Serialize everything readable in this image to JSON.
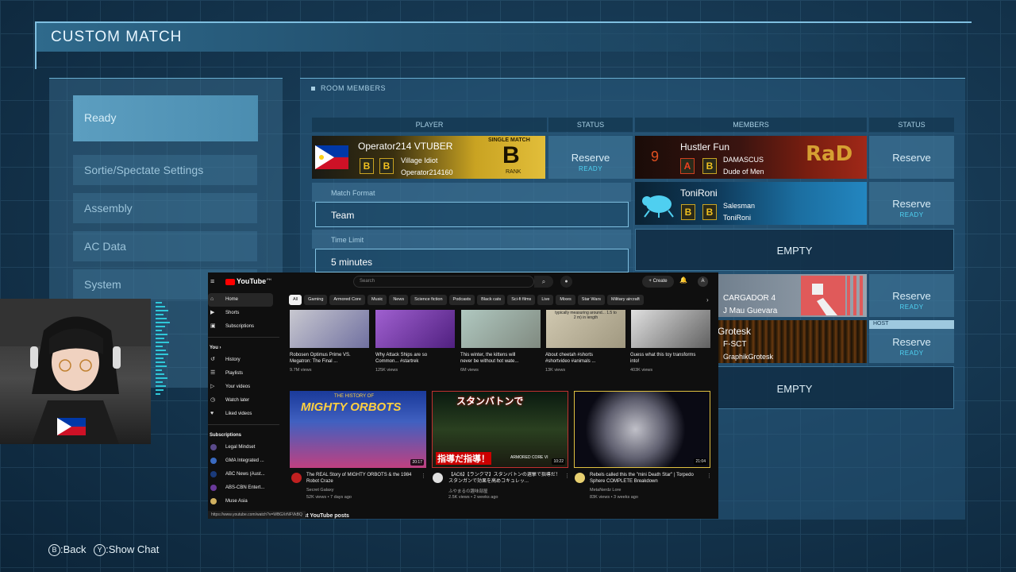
{
  "screen_title": "CUSTOM MATCH",
  "menu": {
    "items": [
      "Ready",
      "Sortie/Spectate Settings",
      "Assembly",
      "AC Data",
      "System"
    ]
  },
  "room": {
    "label": "ROOM MEMBERS",
    "headers": {
      "player": "PLAYER",
      "status_left": "STATUS",
      "members": "MEMBERS",
      "status_right": "STATUS"
    },
    "host_player": {
      "name": "Operator214 VTUBER",
      "title": "Village Idiot",
      "id": "Operator214160",
      "rank_label": "SINGLE MATCH",
      "rank": "B",
      "rank_word": "RANK",
      "badges": [
        "B",
        "B"
      ],
      "status": "Reserve",
      "status_sub": "READY"
    },
    "match_format": {
      "label": "Match Format",
      "value": "Team"
    },
    "time_limit": {
      "label": "Time Limit",
      "value": "5 minutes"
    },
    "members": [
      {
        "name": "Hustler Fun",
        "emblem_num": "9",
        "title": "DAMASCUS",
        "id": "Dude of Men",
        "badges": [
          "A",
          "B"
        ],
        "logo": "RaD",
        "status": "Reserve",
        "status_sub": ""
      },
      {
        "name": "ToniRoni",
        "title": "Salesman",
        "id": "ToniRoni",
        "badges": [
          "B",
          "B"
        ],
        "status": "Reserve",
        "status_sub": "READY"
      },
      {
        "empty_label": "EMPTY"
      },
      {
        "name": "CARGADOR 4",
        "id": "J Mau Guevara",
        "status": "Reserve",
        "status_sub": "READY"
      },
      {
        "name": "Grotesk",
        "title": "F-SCT",
        "id": "GraphikGrotesk",
        "host_tag": "HOST",
        "status": "Reserve",
        "status_sub": "READY"
      },
      {
        "empty_label": "EMPTY"
      }
    ]
  },
  "youtube": {
    "logo": "YouTube",
    "region": "PH",
    "search_placeholder": "Search",
    "create_label": "Create",
    "sidebar": {
      "main": [
        "Home",
        "Shorts",
        "Subscriptions"
      ],
      "you_heading": "You",
      "you_items": [
        "History",
        "Playlists",
        "Your videos",
        "Watch later",
        "Liked videos"
      ],
      "subs_heading": "Subscriptions",
      "subs": [
        "Legal Mindset",
        "GMA Integrated ...",
        "ABC News (Aust...",
        "ABS-CBN Entert...",
        "Muse Asia"
      ]
    },
    "chips": [
      "All",
      "Gaming",
      "Armored Core",
      "Music",
      "News",
      "Science fiction",
      "Podcasts",
      "Black cats",
      "Sci-fi films",
      "Live",
      "Mixes",
      "Star Wars",
      "Military aircraft"
    ],
    "shorts": [
      {
        "title": "Robosen Optimus Prime VS. Megatron: The Final ...",
        "views": "9.7M views"
      },
      {
        "title": "Why Attack Ships are so Common... #startrek",
        "views": "125K views"
      },
      {
        "title": "This winter, the kittens will never be without hot wate...",
        "views": "6M views"
      },
      {
        "title": "About cheetah #shorts #shortvideo #animals ...",
        "views": "13K views",
        "overlay": "typically measuring around... 1.5 to 2 m) in length"
      },
      {
        "title": "Guess what this toy transforms into!",
        "views": "403K views"
      }
    ],
    "videos": [
      {
        "title": "The REAL Story of MIGHTY ORBOTS & the 1984 Robot Craze",
        "channel": "Secret Galaxy",
        "meta": "52K views • 7 days ago",
        "duration": "20:17",
        "thumb_text": "MIGHTY ORBOTS",
        "thumb_small": "THE HISTORY OF"
      },
      {
        "title": "【AC6】【ランクマ】スタンバトンの選撃で指導だ！スタンガンで効果を高めコキュレッ...",
        "channel": "ふやまるの趣味部屋",
        "meta": "2.5K views • 2 weeks ago",
        "duration": "10:22",
        "thumb_text": "スタンバトンで",
        "thumb_bottom": "指導だ指導！",
        "thumb_logo": "ARMORED CORE VI"
      },
      {
        "title": "Rebels called this the \"mini Death Star\" | Torpedo Sphere COMPLETE Breakdown",
        "channel": "MetaNerdz Lore",
        "meta": "83K views • 3 weeks ago",
        "duration": "21:04"
      }
    ],
    "section_heading": "Latest YouTube posts",
    "status_url": "https://www.youtube.com/watch?v=WBGXrNFVkBQ"
  },
  "footer": {
    "back_glyph": "B",
    "back_label": ":Back",
    "chat_glyph": "Y",
    "chat_label": ":Show Chat"
  }
}
